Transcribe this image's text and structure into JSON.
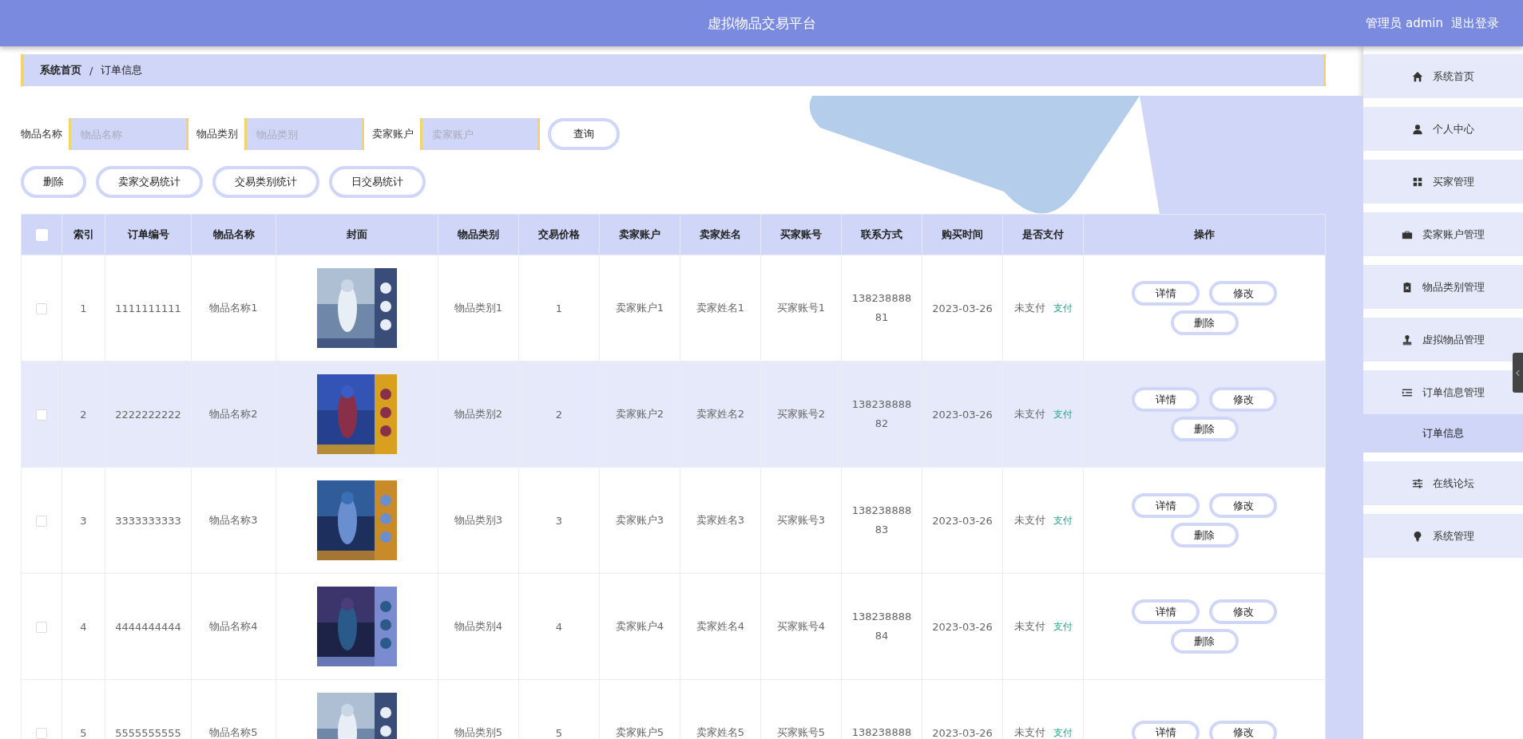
{
  "header": {
    "title": "虚拟物品交易平台",
    "user": "管理员 admin",
    "logout": "退出登录"
  },
  "breadcrumb": [
    {
      "label": "系统首页",
      "current": false
    },
    {
      "label": "订单信息",
      "current": true
    }
  ],
  "breadcrumb_separator": "/",
  "search": {
    "fields": [
      {
        "label": "物品名称",
        "placeholder": "物品名称"
      },
      {
        "label": "物品类别",
        "placeholder": "物品类别"
      },
      {
        "label": "卖家账户",
        "placeholder": "卖家账户"
      }
    ],
    "button": "查询"
  },
  "actions": [
    "删除",
    "卖家交易统计",
    "交易类别统计",
    "日交易统计"
  ],
  "table": {
    "select_all": {
      "checked": false
    },
    "columns": [
      "索引",
      "订单编号",
      "物品名称",
      "封面",
      "物品类别",
      "交易价格",
      "卖家账户",
      "卖家姓名",
      "买家账号",
      "联系方式",
      "购买时间",
      "是否支付",
      "操作"
    ],
    "rows": [
      {
        "checked": false,
        "hovered": false,
        "index": "1",
        "order_no": "1111111111",
        "item_name": "物品名称1",
        "category": "物品类别1",
        "price": "1",
        "seller_account": "卖家账户1",
        "seller_name": "卖家姓名1",
        "buyer_account": "买家账号1",
        "phone": [
          "138238888",
          "81"
        ],
        "date": "2023-03-26",
        "pay_status": "未支付",
        "pay_link": "支付",
        "buttons": [
          "详情",
          "修改",
          "删除"
        ]
      },
      {
        "checked": false,
        "hovered": true,
        "index": "2",
        "order_no": "2222222222",
        "item_name": "物品名称2",
        "category": "物品类别2",
        "price": "2",
        "seller_account": "卖家账户2",
        "seller_name": "卖家姓名2",
        "buyer_account": "买家账号2",
        "phone": [
          "138238888",
          "82"
        ],
        "date": "2023-03-26",
        "pay_status": "未支付",
        "pay_link": "支付",
        "buttons": [
          "详情",
          "修改",
          "删除"
        ]
      },
      {
        "checked": false,
        "hovered": false,
        "index": "3",
        "order_no": "3333333333",
        "item_name": "物品名称3",
        "category": "物品类别3",
        "price": "3",
        "seller_account": "卖家账户3",
        "seller_name": "卖家姓名3",
        "buyer_account": "买家账号3",
        "phone": [
          "138238888",
          "83"
        ],
        "date": "2023-03-26",
        "pay_status": "未支付",
        "pay_link": "支付",
        "buttons": [
          "详情",
          "修改",
          "删除"
        ]
      },
      {
        "checked": false,
        "hovered": false,
        "index": "4",
        "order_no": "4444444444",
        "item_name": "物品名称4",
        "category": "物品类别4",
        "price": "4",
        "seller_account": "卖家账户4",
        "seller_name": "卖家姓名4",
        "buyer_account": "买家账号4",
        "phone": [
          "138238888",
          "84"
        ],
        "date": "2023-03-26",
        "pay_status": "未支付",
        "pay_link": "支付",
        "buttons": [
          "详情",
          "修改",
          "删除"
        ]
      },
      {
        "checked": false,
        "hovered": false,
        "index": "5",
        "order_no": "5555555555",
        "item_name": "物品名称5",
        "category": "物品类别5",
        "price": "5",
        "seller_account": "卖家账户5",
        "seller_name": "卖家姓名5",
        "buyer_account": "买家账号5",
        "phone": [
          "138238888"
        ],
        "date": "2023-03-26",
        "pay_status": "未支付",
        "pay_link": "支付",
        "buttons": [
          "详情",
          "修改"
        ]
      }
    ]
  },
  "sidebar": {
    "items": [
      {
        "label": "系统首页",
        "selected": false
      },
      {
        "label": "个人中心",
        "selected": false
      },
      {
        "label": "买家管理",
        "selected": false
      },
      {
        "label": "卖家账户管理",
        "selected": false
      },
      {
        "label": "物品类别管理",
        "selected": false
      },
      {
        "label": "虚拟物品管理",
        "selected": false
      },
      {
        "label": "订单信息管理",
        "selected": false,
        "expanded": true,
        "children": [
          {
            "label": "订单信息",
            "selected": true
          }
        ]
      },
      {
        "label": "在线论坛",
        "selected": false
      },
      {
        "label": "系统管理",
        "selected": false
      }
    ]
  }
}
